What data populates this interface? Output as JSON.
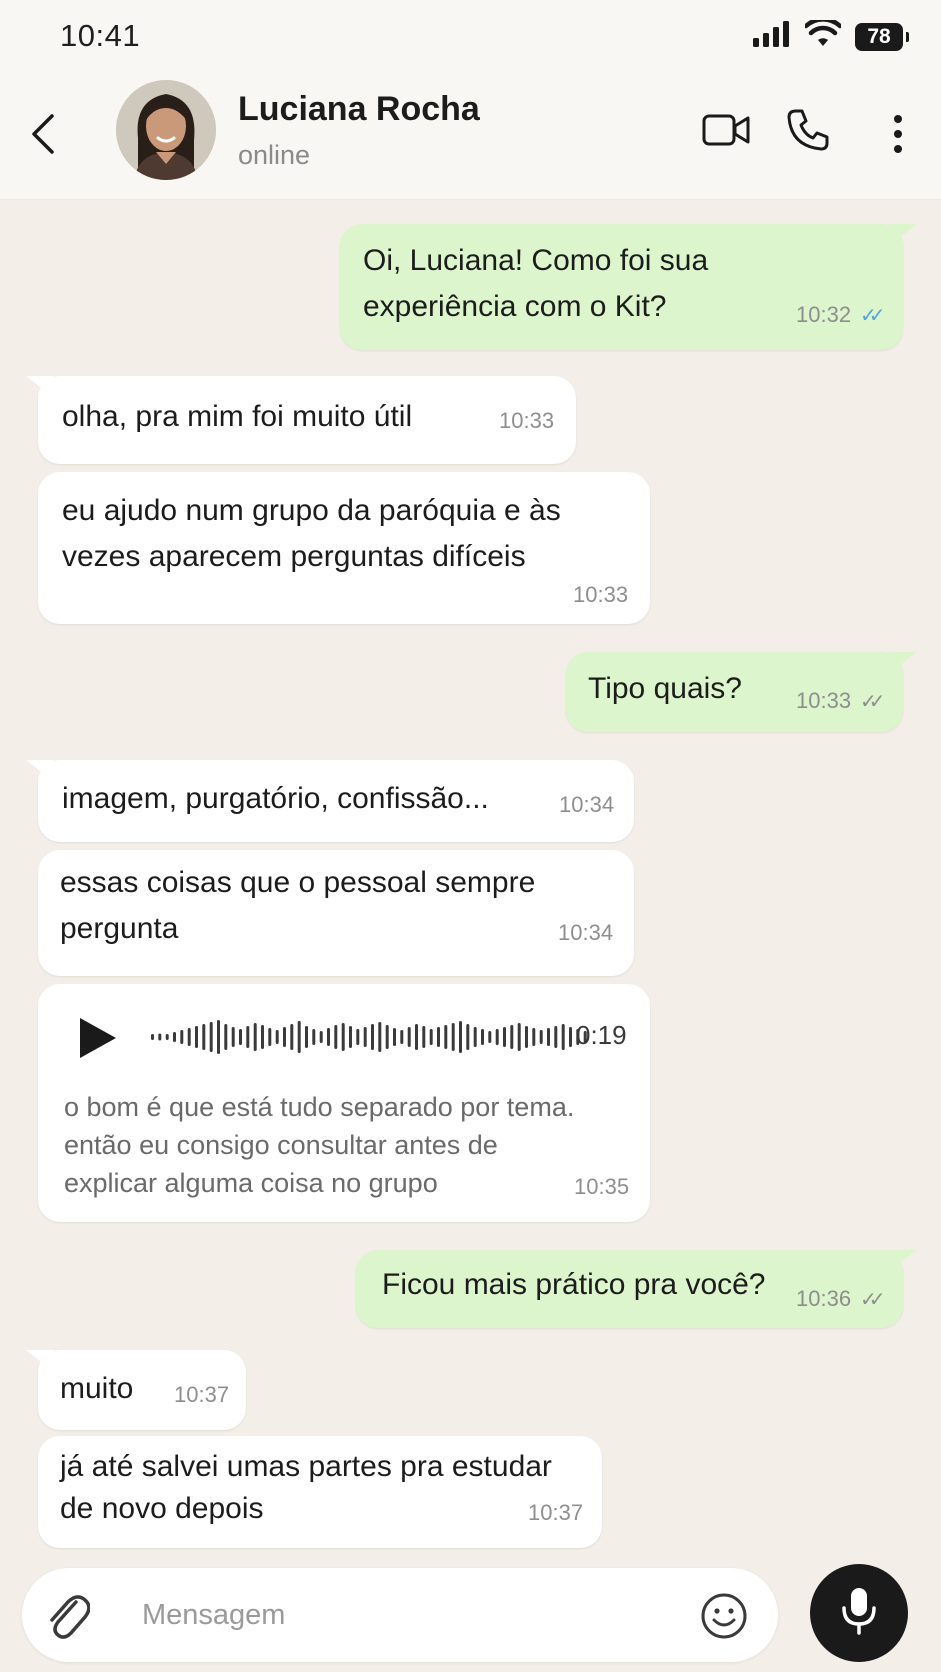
{
  "status_bar": {
    "time": "10:41",
    "battery": "78"
  },
  "header": {
    "name": "Luciana Rocha",
    "status": "online",
    "icons": [
      "back-arrow-icon",
      "video-camera-icon",
      "phone-icon",
      "more-vertical-icon"
    ]
  },
  "messages": [
    {
      "dir": "out",
      "text": "Oi, Luciana! Como foi sua\nexperiência com o Kit?",
      "time": "10:32",
      "status": "read"
    },
    {
      "dir": "in",
      "text": "olha, pra mim foi muito útil",
      "time": "10:33"
    },
    {
      "dir": "in",
      "text": "eu ajudo num grupo da paróquia e às\nvezes aparecem perguntas difíceis",
      "time": "10:33"
    },
    {
      "dir": "out",
      "text": "Tipo quais?",
      "time": "10:33",
      "status": "delivered"
    },
    {
      "dir": "in",
      "text": "imagem, purgatório, confissão...",
      "time": "10:34"
    },
    {
      "dir": "in",
      "text": "essas coisas que o pessoal sempre\npergunta",
      "time": "10:34"
    },
    {
      "dir": "in",
      "type": "voice",
      "duration": "0:19",
      "transcript": "o bom é que está tudo separado por tema.\nentão eu consigo consultar antes de\nexplicar alguma coisa no grupo",
      "time": "10:35"
    },
    {
      "dir": "out",
      "text": "Ficou mais prático pra você?",
      "time": "10:36",
      "status": "delivered"
    },
    {
      "dir": "in",
      "text": "muito",
      "time": "10:37"
    },
    {
      "dir": "in",
      "text": "já até salvei umas partes pra estudar\nde novo depois",
      "time": "10:37"
    }
  ],
  "composer": {
    "placeholder": "Mensagem"
  },
  "colors": {
    "outgoing": "#dcf5cc",
    "incoming": "#ffffff",
    "background": "#f3efe8",
    "read_ticks": "#4fa3e0",
    "mic_button": "#1a1a1a"
  }
}
